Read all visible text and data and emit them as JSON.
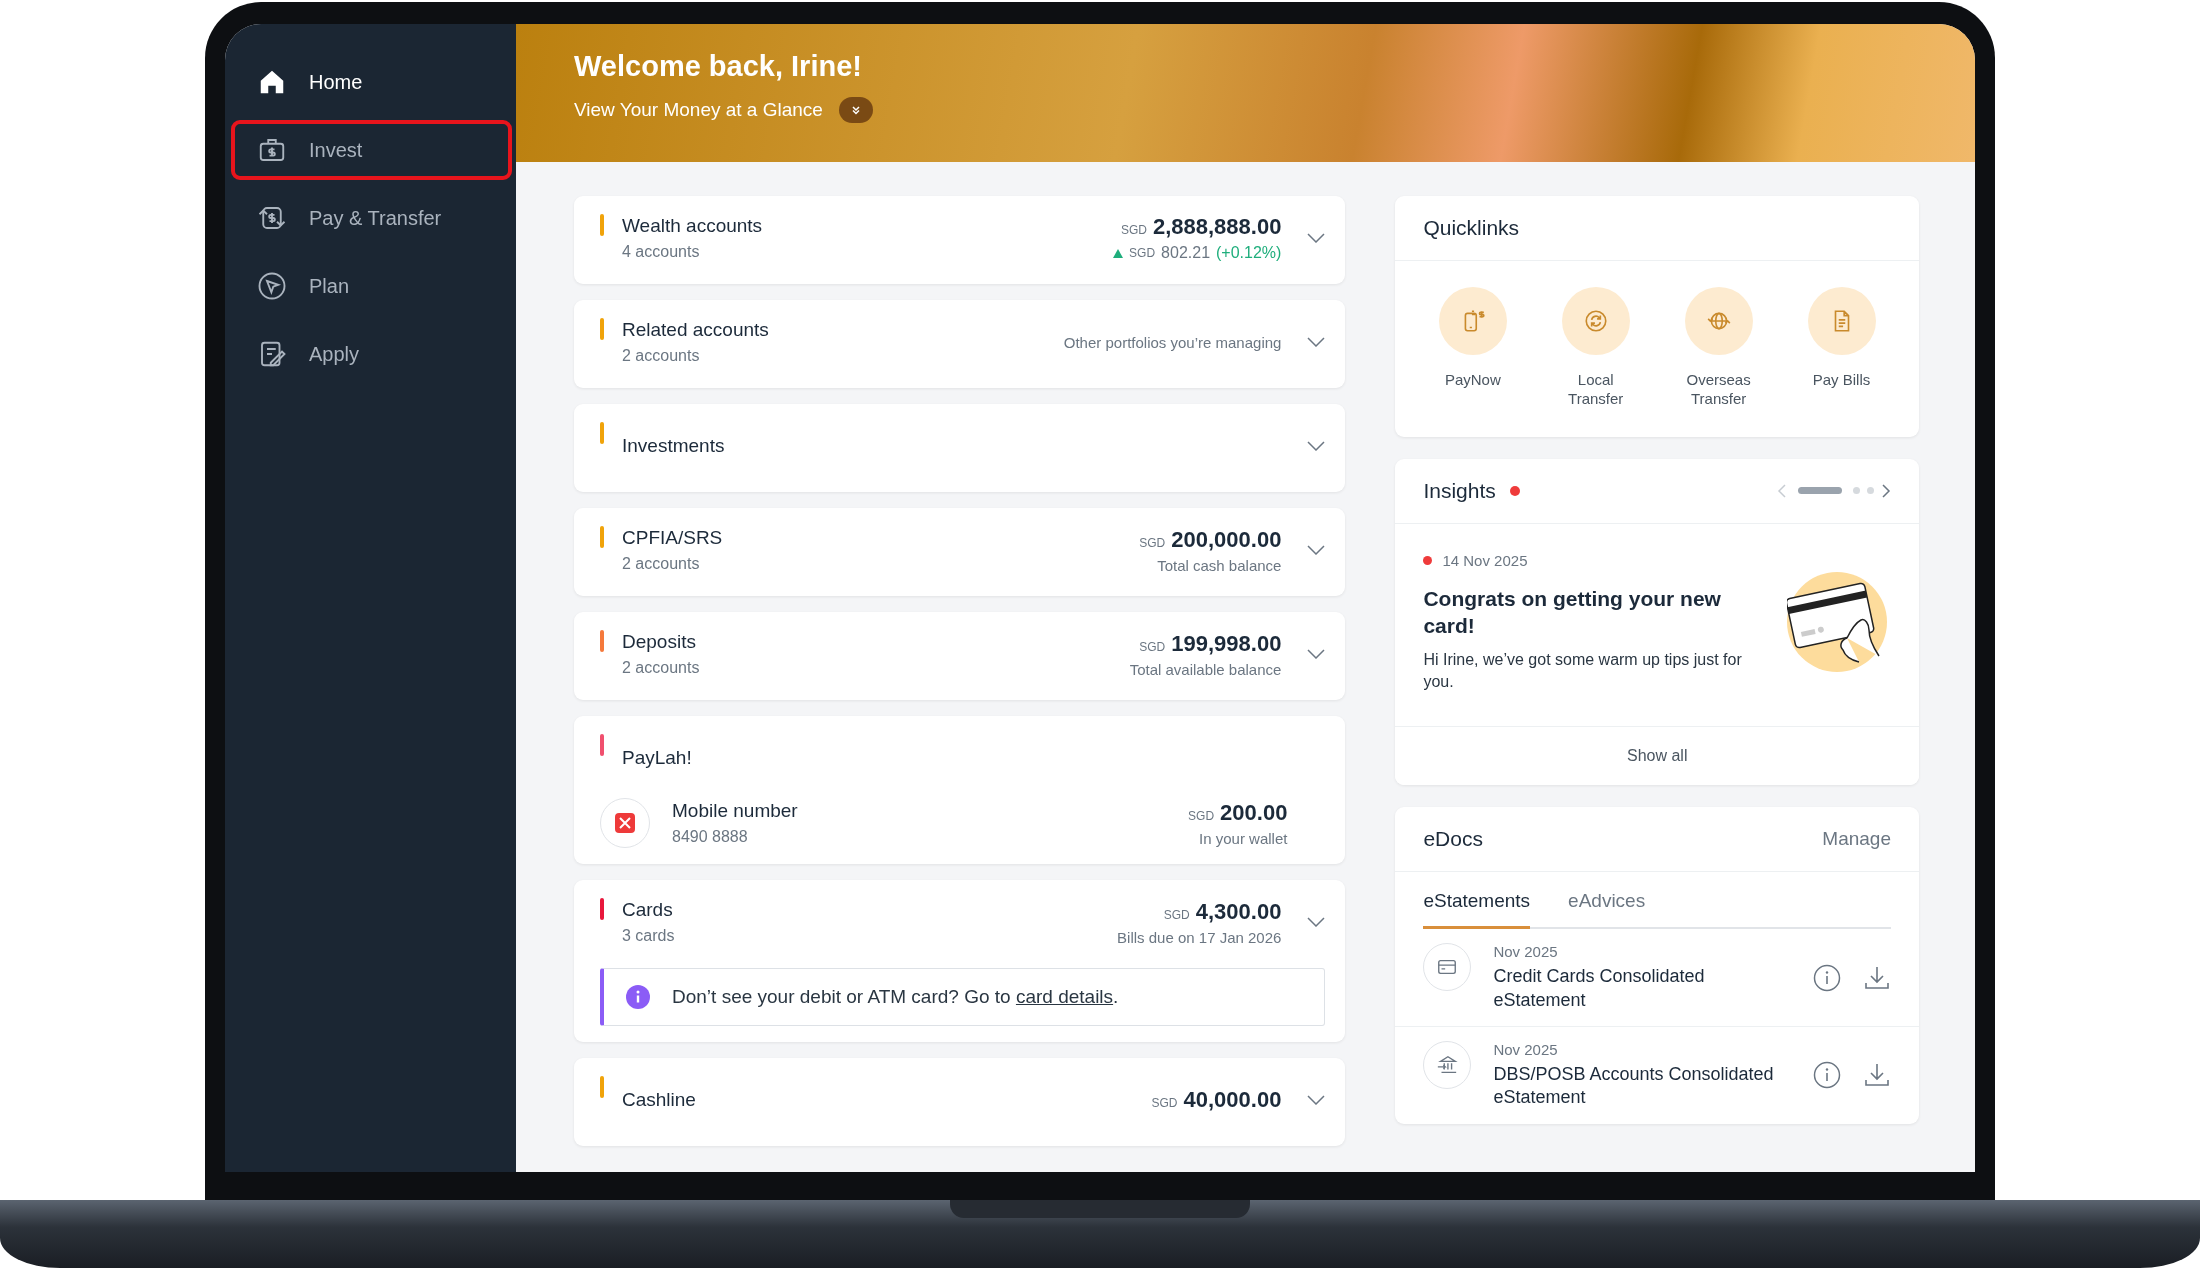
{
  "sidebar": {
    "items": [
      {
        "label": "Home",
        "selected": true,
        "highlighted": false
      },
      {
        "label": "Invest",
        "selected": false,
        "highlighted": true
      },
      {
        "label": "Pay & Transfer",
        "selected": false,
        "highlighted": false
      },
      {
        "label": "Plan",
        "selected": false,
        "highlighted": false
      },
      {
        "label": "Apply",
        "selected": false,
        "highlighted": false
      }
    ]
  },
  "header": {
    "title": "Welcome back, Irine!",
    "subtitle": "View Your Money at a Glance"
  },
  "accounts": [
    {
      "kind": "account",
      "title": "Wealth accounts",
      "subtitle": "4 accounts",
      "color": "#f0a30a",
      "currency": "SGD",
      "amount": "2,888,888.00",
      "change": {
        "up": true,
        "currency": "SGD",
        "value": "802.21",
        "percent": "(+0.12%)"
      }
    },
    {
      "kind": "account",
      "title": "Related accounts",
      "subtitle": "2 accounts",
      "color": "#f0a30a",
      "note": "Other portfolios you’re managing"
    },
    {
      "kind": "account",
      "title": "Investments",
      "color": "#f0a30a"
    },
    {
      "kind": "account",
      "title": "CPFIA/SRS",
      "subtitle": "2 accounts",
      "color": "#f0a30a",
      "currency": "SGD",
      "amount": "200,000.00",
      "caption": "Total cash balance"
    },
    {
      "kind": "account",
      "title": "Deposits",
      "subtitle": "2 accounts",
      "color": "#f5793b",
      "currency": "SGD",
      "amount": "199,998.00",
      "caption": "Total available balance"
    },
    {
      "kind": "wallet",
      "title": "PayLah!",
      "color": "#f0506e",
      "name": "Mobile number",
      "number": "8490 8888",
      "currency": "SGD",
      "amount": "200.00",
      "caption": "In your wallet"
    },
    {
      "kind": "account",
      "title": "Cards",
      "subtitle": "3 cards",
      "color": "#e8173c",
      "currency": "SGD",
      "amount": "4,300.00",
      "caption": "Bills due on 17 Jan 2026",
      "banner": {
        "text": "Don’t see your debit or ATM card? Go to",
        "link": "card details",
        "end": "."
      }
    },
    {
      "kind": "account",
      "title": "Cashline",
      "color": "#f0a30a",
      "currency": "SGD",
      "amount": "40,000.00"
    }
  ],
  "quicklinks": {
    "title": "Quicklinks",
    "items": [
      {
        "label": "PayNow"
      },
      {
        "label": "Local Transfer"
      },
      {
        "label": "Overseas Transfer"
      },
      {
        "label": "Pay Bills"
      }
    ]
  },
  "insights": {
    "title": "Insights",
    "unread": true,
    "pager": [
      {
        "selected": true
      },
      {
        "selected": false
      },
      {
        "selected": false
      }
    ],
    "card": {
      "unread": true,
      "date": "14 Nov 2025",
      "title": "Congrats on getting your new card!",
      "body": "Hi Irine, we’ve got some warm up tips just for you."
    },
    "footer": "Show all"
  },
  "edocs": {
    "title": "eDocs",
    "action": "Manage",
    "tabs": [
      {
        "label": "eStatements",
        "selected": true
      },
      {
        "label": "eAdvices",
        "selected": false
      }
    ],
    "items": [
      {
        "date": "Nov 2025",
        "title": "Credit Cards Consolidated eStatement"
      },
      {
        "date": "Nov 2025",
        "title": "DBS/POSB Accounts Consolidated eStatement"
      }
    ]
  }
}
